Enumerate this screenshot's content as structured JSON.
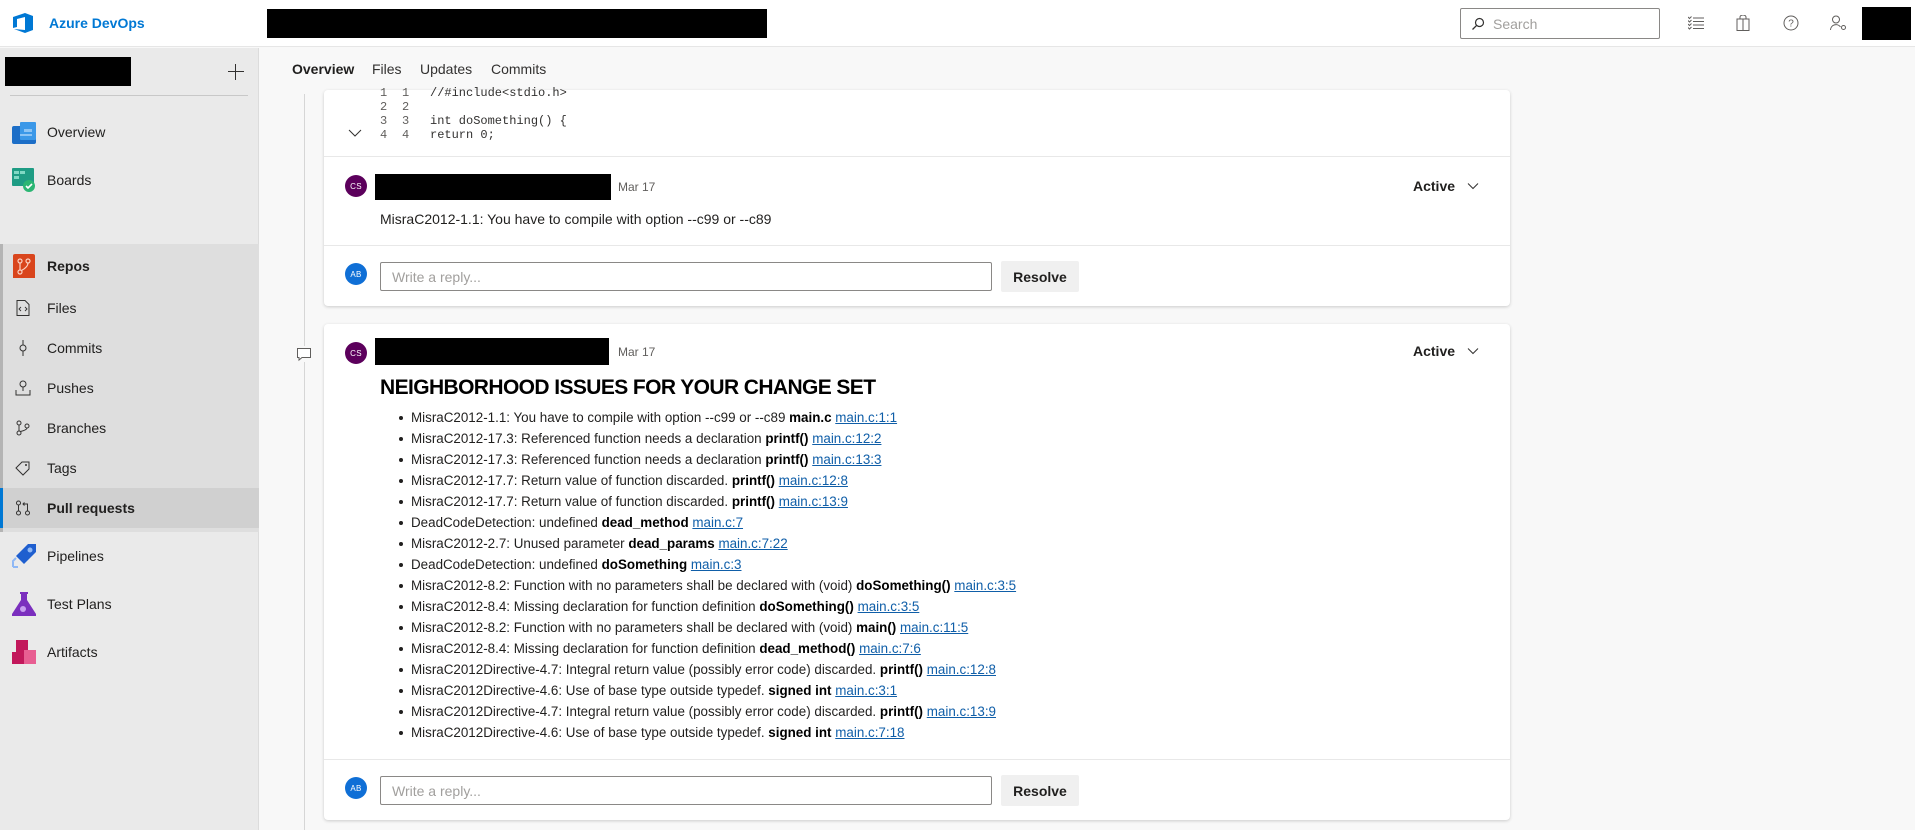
{
  "header": {
    "brand": "Azure DevOps",
    "search_placeholder": "Search",
    "icons": [
      "task-list-icon",
      "shopping-bag-icon",
      "help-icon",
      "user-settings-icon"
    ]
  },
  "sidebar": {
    "add_label": "+",
    "items": [
      {
        "label": "Overview",
        "icon": "overview-icon"
      },
      {
        "label": "Boards",
        "icon": "boards-icon"
      },
      {
        "label": "Repos",
        "icon": "repos-icon"
      },
      {
        "label": "Files",
        "icon": "files-icon"
      },
      {
        "label": "Commits",
        "icon": "commits-icon"
      },
      {
        "label": "Pushes",
        "icon": "pushes-icon"
      },
      {
        "label": "Branches",
        "icon": "branches-icon"
      },
      {
        "label": "Tags",
        "icon": "tags-icon"
      },
      {
        "label": "Pull requests",
        "icon": "pull-requests-icon",
        "selected": true
      },
      {
        "label": "Pipelines",
        "icon": "pipelines-icon"
      },
      {
        "label": "Test Plans",
        "icon": "test-plans-icon"
      },
      {
        "label": "Artifacts",
        "icon": "artifacts-icon"
      }
    ]
  },
  "tabs": [
    {
      "label": "Overview",
      "active": true
    },
    {
      "label": "Files"
    },
    {
      "label": "Updates"
    },
    {
      "label": "Commits"
    }
  ],
  "code_snippet": [
    {
      "old": "1",
      "new": "1",
      "text": "//#include<stdio.h>"
    },
    {
      "old": "2",
      "new": "2",
      "text": ""
    },
    {
      "old": "3",
      "new": "3",
      "text": "int doSomething() {"
    },
    {
      "old": "4",
      "new": "4",
      "text": "  return 0;"
    }
  ],
  "threads": [
    {
      "author_initials": "CS",
      "date": "Mar 17",
      "status": "Active",
      "comment": "MisraC2012-1.1: You have to compile with option --c99 or --c89",
      "reply_initials": "AB",
      "reply_placeholder": "Write a reply...",
      "resolve_label": "Resolve"
    },
    {
      "author_initials": "CS",
      "date": "Mar 17",
      "status": "Active",
      "title": "NEIGHBORHOOD ISSUES FOR YOUR CHANGE SET",
      "issues": [
        {
          "text": "MisraC2012-1.1: You have to compile with option --c99 or --c89",
          "symbol": "main.c",
          "link": "main.c:1:1"
        },
        {
          "text": "MisraC2012-17.3: Referenced function needs a declaration",
          "symbol": "printf()",
          "link": "main.c:12:2"
        },
        {
          "text": "MisraC2012-17.3: Referenced function needs a declaration",
          "symbol": "printf()",
          "link": "main.c:13:3"
        },
        {
          "text": "MisraC2012-17.7: Return value of function discarded.",
          "symbol": "printf()",
          "link": "main.c:12:8"
        },
        {
          "text": "MisraC2012-17.7: Return value of function discarded.",
          "symbol": "printf()",
          "link": "main.c:13:9"
        },
        {
          "text": "DeadCodeDetection: undefined",
          "symbol": "dead_method",
          "link": "main.c:7"
        },
        {
          "text": "MisraC2012-2.7: Unused parameter",
          "symbol": "dead_params",
          "link": "main.c:7:22"
        },
        {
          "text": "DeadCodeDetection: undefined",
          "symbol": "doSomething",
          "link": "main.c:3"
        },
        {
          "text": "MisraC2012-8.2: Function with no parameters shall be declared with (void)",
          "symbol": "doSomething()",
          "link": "main.c:3:5"
        },
        {
          "text": "MisraC2012-8.4: Missing declaration for function definition",
          "symbol": "doSomething()",
          "link": "main.c:3:5"
        },
        {
          "text": "MisraC2012-8.2: Function with no parameters shall be declared with (void)",
          "symbol": "main()",
          "link": "main.c:11:5"
        },
        {
          "text": "MisraC2012-8.4: Missing declaration for function definition",
          "symbol": "dead_method()",
          "link": "main.c:7:6"
        },
        {
          "text": "MisraC2012Directive-4.7: Integral return value (possibly error code) discarded.",
          "symbol": "printf()",
          "link": "main.c:12:8"
        },
        {
          "text": "MisraC2012Directive-4.6: Use of base type outside typedef.",
          "symbol": "signed int",
          "link": "main.c:3:1"
        },
        {
          "text": "MisraC2012Directive-4.7: Integral return value (possibly error code) discarded.",
          "symbol": "printf()",
          "link": "main.c:13:9"
        },
        {
          "text": "MisraC2012Directive-4.6: Use of base type outside typedef.",
          "symbol": "signed int",
          "link": "main.c:7:18"
        }
      ],
      "reply_initials": "AB",
      "reply_placeholder": "Write a reply...",
      "resolve_label": "Resolve"
    }
  ],
  "colors": {
    "accent": "#0078d4",
    "avatar_cs": "#5c005c",
    "avatar_ab": "#0f6fd6",
    "link": "#0f5ea8"
  }
}
